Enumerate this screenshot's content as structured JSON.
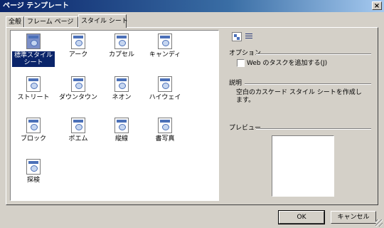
{
  "window": {
    "title": "ページ テンプレート",
    "close_glyph": "×"
  },
  "tabs": [
    "全般",
    "フレーム ページ",
    "スタイル シート"
  ],
  "active_tab": 2,
  "templates": [
    {
      "label": "標準スタイル シート",
      "selected": true
    },
    {
      "label": "アーク",
      "selected": false
    },
    {
      "label": "カプセル",
      "selected": false
    },
    {
      "label": "キャンディ",
      "selected": false
    },
    {
      "label": "ストリート",
      "selected": false
    },
    {
      "label": "ダウンタウン",
      "selected": false
    },
    {
      "label": "ネオン",
      "selected": false
    },
    {
      "label": "ハイウェイ",
      "selected": false
    },
    {
      "label": "ブロック",
      "selected": false
    },
    {
      "label": "ポエム",
      "selected": false
    },
    {
      "label": "縦線",
      "selected": false
    },
    {
      "label": "書写真",
      "selected": false
    },
    {
      "label": "探検",
      "selected": false
    }
  ],
  "options": {
    "label": "オプション",
    "checkbox_label": "Web のタスクを追加する(J)",
    "checked": false
  },
  "description": {
    "label": "説明",
    "text": "空白のカスケード スタイル シートを作成します。"
  },
  "preview": {
    "label": "プレビュー"
  },
  "buttons": {
    "ok": "OK",
    "cancel": "キャンセル"
  },
  "colors": {
    "titlebar": "#0a246a",
    "selection": "#0a246a",
    "face": "#d4d0c8"
  }
}
